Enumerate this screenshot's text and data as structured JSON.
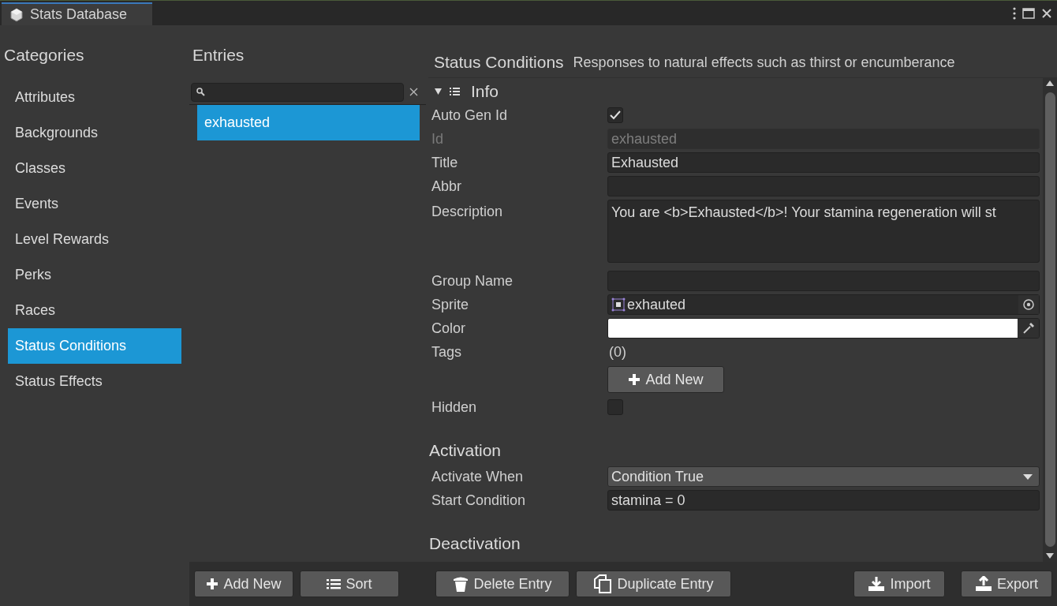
{
  "window": {
    "title": "Stats Database"
  },
  "categories": {
    "title": "Categories",
    "items": [
      {
        "label": "Attributes",
        "selected": false
      },
      {
        "label": "Backgrounds",
        "selected": false
      },
      {
        "label": "Classes",
        "selected": false
      },
      {
        "label": "Events",
        "selected": false
      },
      {
        "label": "Level Rewards",
        "selected": false
      },
      {
        "label": "Perks",
        "selected": false
      },
      {
        "label": "Races",
        "selected": false
      },
      {
        "label": "Status Conditions",
        "selected": true
      },
      {
        "label": "Status Effects",
        "selected": false
      }
    ]
  },
  "entries": {
    "title": "Entries",
    "items": [
      {
        "label": "exhausted",
        "selected": true
      }
    ],
    "buttons": [
      "Add New",
      "Sort"
    ]
  },
  "details": {
    "title": "Status Conditions",
    "subtitle": "Responses to natural effects such as thirst or encumberance",
    "sections": [
      {
        "kind": "foldout",
        "title": "Info",
        "expanded": true,
        "fields": [
          {
            "kind": "checkbox",
            "label": "Auto Gen Id",
            "checked": true
          },
          {
            "kind": "text",
            "label": "Id",
            "value": "exhausted",
            "disabled": true
          },
          {
            "kind": "text",
            "label": "Title",
            "value": "Exhausted",
            "disabled": false
          },
          {
            "kind": "text",
            "label": "Abbr",
            "disabled": false
          },
          {
            "kind": "textarea",
            "label": "Description",
            "value": "You are <b>Exhausted</b>! Your stamina regeneration will st"
          },
          {
            "kind": "text",
            "label": "Group Name",
            "disabled": false
          },
          {
            "kind": "object",
            "label": "Sprite",
            "value": "exhauted"
          },
          {
            "kind": "color",
            "label": "Color",
            "color": "#ffffff"
          },
          {
            "kind": "list",
            "label": "Tags",
            "count": "(0)",
            "button": "Add New"
          },
          {
            "kind": "checkbox",
            "label": "Hidden",
            "checked": false
          }
        ]
      },
      {
        "kind": "group",
        "title": "Activation",
        "fields": [
          {
            "kind": "dropdown",
            "label": "Activate When",
            "value": "Condition True"
          },
          {
            "kind": "text",
            "label": "Start Condition",
            "value": "stamina = 0",
            "disabled": false
          }
        ]
      },
      {
        "kind": "group",
        "title": "Deactivation"
      }
    ]
  },
  "footer": {
    "left": [
      "Delete Entry",
      "Duplicate Entry"
    ],
    "right": [
      "Import",
      "Export"
    ]
  }
}
